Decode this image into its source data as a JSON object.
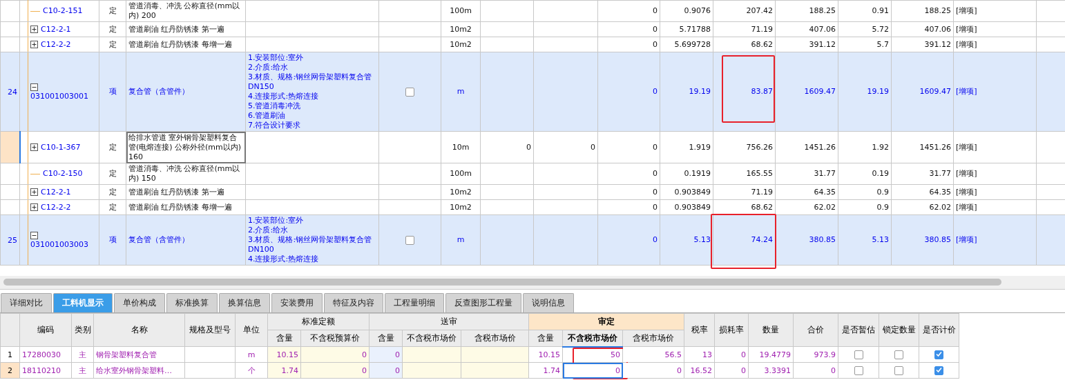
{
  "top_table": {
    "rows": [
      {
        "kind": "quota",
        "expandable": false,
        "selected": false,
        "code": "C10-2-151",
        "type": "定",
        "name": "管道消毒、冲洗 公称直径(mm以内) 200",
        "features": [],
        "unit": "100m",
        "column_11": "0",
        "column_12": "0.9076",
        "column_13": "207.42",
        "column_14": "188.25",
        "column_15": "0.91",
        "column_16": "188.25",
        "note": "[增项]"
      },
      {
        "kind": "quota",
        "expandable": true,
        "expanded": false,
        "selected": false,
        "code": "C12-2-1",
        "type": "定",
        "name": "管道刷油 红丹防锈漆 第一遍",
        "features": [],
        "unit": "10m2",
        "column_11": "0",
        "column_12": "5.71788",
        "column_13": "71.19",
        "column_14": "407.06",
        "column_15": "5.72",
        "column_16": "407.06",
        "note": "[增项]"
      },
      {
        "kind": "quota",
        "expandable": true,
        "expanded": false,
        "selected": false,
        "code": "C12-2-2",
        "type": "定",
        "name": "管道刷油 红丹防锈漆 每增一遍",
        "features": [],
        "unit": "10m2",
        "column_11": "0",
        "column_12": "5.699728",
        "column_13": "68.62",
        "column_14": "391.12",
        "column_15": "5.7",
        "column_16": "391.12",
        "note": "[增项]"
      },
      {
        "kind": "item",
        "number": "24",
        "expandable": true,
        "expanded": true,
        "selected": false,
        "code": "031001003001",
        "type": "项",
        "name": "复合管（含管件）",
        "features": [
          "1.安装部位:室外",
          "2.介质:给水",
          "3.材质、规格:钢丝网骨架塑料复合管DN150",
          "4.连接形式:热熔连接",
          "5.管道消毒冲洗",
          "6.管道刷油",
          "7.符合设计要求"
        ],
        "checked": false,
        "unit": "m",
        "column_11": "0",
        "column_12": "19.19",
        "column_13": "83.87",
        "column_14": "1609.47",
        "column_15": "19.19",
        "column_16": "1609.47",
        "marked": true,
        "note": "[增项]"
      },
      {
        "kind": "quota",
        "expandable": true,
        "expanded": false,
        "selected": true,
        "code": "C10-1-367",
        "type": "定",
        "name": "给排水管道 室外钢骨架塑料复合管(电熔连接) 公称外径(mm以内) 160",
        "features": [],
        "unit": "10m",
        "column_9": "0",
        "column_10": "0",
        "column_11": "0",
        "column_12": "1.919",
        "column_13": "756.26",
        "column_14": "1451.26",
        "column_15": "1.92",
        "column_16": "1451.26",
        "note": "[增项]"
      },
      {
        "kind": "quota",
        "expandable": false,
        "selected": false,
        "code": "C10-2-150",
        "type": "定",
        "name": "管道消毒、冲洗 公称直径(mm以内) 150",
        "features": [],
        "unit": "100m",
        "column_11": "0",
        "column_12": "0.1919",
        "column_13": "165.55",
        "column_14": "31.77",
        "column_15": "0.19",
        "column_16": "31.77",
        "note": "[增项]"
      },
      {
        "kind": "quota",
        "expandable": true,
        "expanded": false,
        "selected": false,
        "code": "C12-2-1",
        "type": "定",
        "name": "管道刷油 红丹防锈漆 第一遍",
        "features": [],
        "unit": "10m2",
        "column_11": "0",
        "column_12": "0.903849",
        "column_13": "71.19",
        "column_14": "64.35",
        "column_15": "0.9",
        "column_16": "64.35",
        "note": "[增项]"
      },
      {
        "kind": "quota",
        "expandable": true,
        "expanded": false,
        "selected": false,
        "code": "C12-2-2",
        "type": "定",
        "name": "管道刷油 红丹防锈漆 每增一遍",
        "features": [],
        "unit": "10m2",
        "column_11": "0",
        "column_12": "0.903849",
        "column_13": "68.62",
        "column_14": "62.02",
        "column_15": "0.9",
        "column_16": "62.02",
        "note": "[增项]"
      },
      {
        "kind": "item",
        "number": "25",
        "expandable": true,
        "expanded": true,
        "selected": false,
        "code": "031001003003",
        "type": "项",
        "name": "复合管（含管件）",
        "features": [
          "1.安装部位:室外",
          "2.介质:给水",
          "3.材质、规格:钢丝网骨架塑料复合管DN100",
          "4.连接形式:热熔连接"
        ],
        "checked": false,
        "unit": "m",
        "column_11": "0",
        "column_12": "5.13",
        "column_13": "74.24",
        "column_14": "380.85",
        "column_15": "5.13",
        "column_16": "380.85",
        "marked": true,
        "note": "[增项]"
      }
    ]
  },
  "tabs": [
    {
      "label": "详细对比",
      "selected": false
    },
    {
      "label": "工料机显示",
      "selected": true
    },
    {
      "label": "单价构成",
      "selected": false
    },
    {
      "label": "标准换算",
      "selected": false
    },
    {
      "label": "换算信息",
      "selected": false
    },
    {
      "label": "安装费用",
      "selected": false
    },
    {
      "label": "特征及内容",
      "selected": false
    },
    {
      "label": "工程量明细",
      "selected": false
    },
    {
      "label": "反查图形工程量",
      "selected": false
    },
    {
      "label": "说明信息",
      "selected": false
    }
  ],
  "bottom_table": {
    "columns": [
      {
        "label": "编码"
      },
      {
        "label": "类别"
      },
      {
        "label": "名称"
      },
      {
        "label": "规格及型号"
      },
      {
        "label": "单位"
      },
      {
        "label": "标准定额",
        "colspan": 2,
        "highlighted": false,
        "columns": [
          {
            "label": "含量",
            "selected": false
          },
          {
            "label": "不含税预算价",
            "selected": false
          }
        ]
      },
      {
        "label": "送审",
        "colspan": 3,
        "highlighted": false,
        "columns": [
          {
            "label": "含量",
            "selected": false
          },
          {
            "label": "不含税市场价",
            "selected": false
          },
          {
            "label": "含税市场价",
            "selected": false
          }
        ]
      },
      {
        "label": "审定",
        "colspan": 3,
        "highlighted": true,
        "columns": [
          {
            "label": "含量",
            "selected": false
          },
          {
            "label": "不含税市场价",
            "selected": true,
            "marked": true
          },
          {
            "label": "含税市场价",
            "selected": false
          }
        ]
      },
      {
        "label": "税率"
      },
      {
        "label": "损耗率"
      },
      {
        "label": "数量"
      },
      {
        "label": "合价"
      },
      {
        "label": "是否暂估"
      },
      {
        "label": "锁定数量"
      },
      {
        "label": "是否计价"
      }
    ],
    "rows": [
      {
        "number": "1",
        "selected": false,
        "cells": [
          "17280030",
          "主",
          "钢骨架塑料复合管",
          null,
          "m",
          "10.15",
          "0",
          "0",
          null,
          null,
          "10.15",
          "50",
          "56.5",
          "13",
          "0",
          "19.4779",
          "973.9"
        ],
        "estimate": false,
        "locked": false,
        "priced": true
      },
      {
        "number": "2",
        "selected": true,
        "cells": [
          "18110210",
          "主",
          "给水室外钢骨架塑料…",
          null,
          "个",
          "1.74",
          "0",
          "0",
          null,
          null,
          "1.74",
          "0",
          "0",
          "16.52",
          "0",
          "3.3391",
          "0"
        ],
        "estimate": false,
        "locked": false,
        "priced": true
      }
    ]
  }
}
